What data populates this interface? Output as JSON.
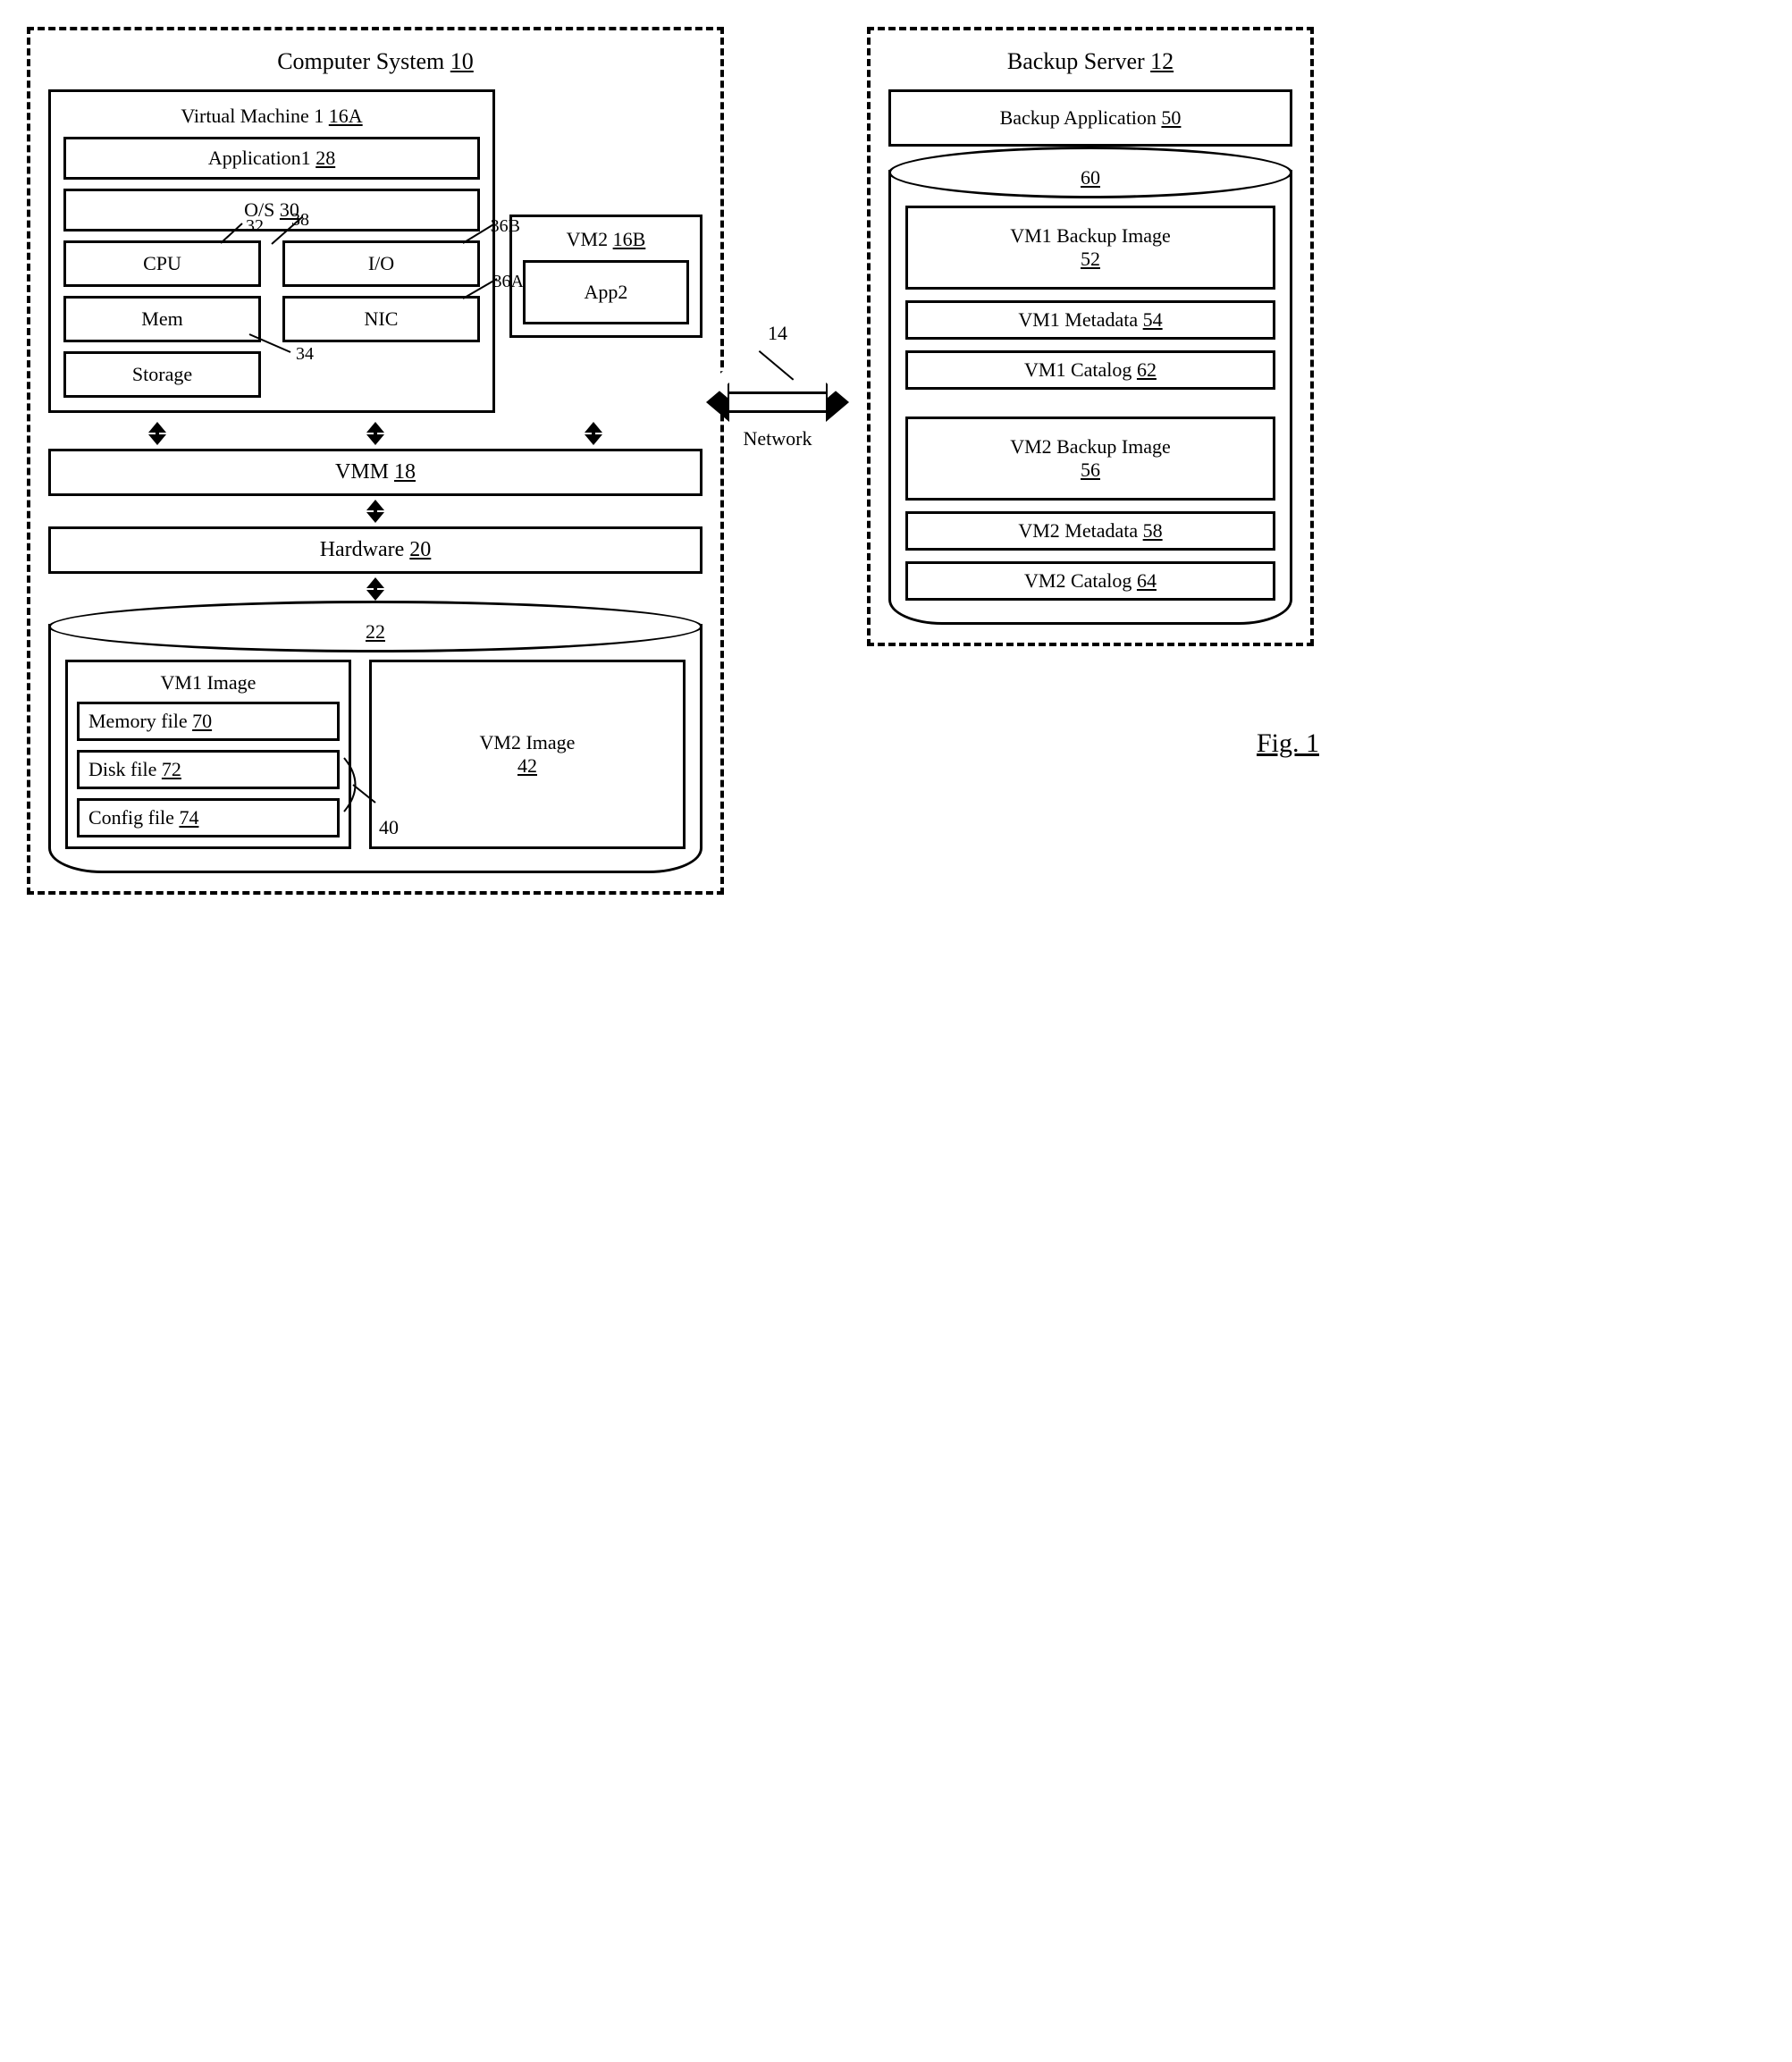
{
  "figure_label": "Fig. 1",
  "computer_system": {
    "title": "Computer System",
    "ref": "10",
    "vm1": {
      "title": "Virtual Machine 1",
      "ref": "16A",
      "app": {
        "label": "Application1",
        "ref": "28"
      },
      "os": {
        "label": "O/S",
        "ref": "30"
      },
      "cpu": {
        "label": "CPU",
        "ref": "32"
      },
      "mem": {
        "label": "Mem",
        "ref": "34"
      },
      "storage": {
        "label": "Storage"
      },
      "io": {
        "label": "I/O",
        "ref": "36B"
      },
      "nic": {
        "label": "NIC",
        "ref": "36A"
      },
      "divider_ref": "38"
    },
    "vm2": {
      "title": "VM2",
      "ref": "16B",
      "app": {
        "label": "App2"
      }
    },
    "vmm": {
      "label": "VMM",
      "ref": "18"
    },
    "hardware": {
      "label": "Hardware",
      "ref": "20"
    },
    "storage_cyl": {
      "ref": "22",
      "vm1_image": {
        "title": "VM1 Image",
        "memory_file": {
          "label": "Memory file",
          "ref": "70"
        },
        "disk_file": {
          "label": "Disk file",
          "ref": "72"
        },
        "config_file": {
          "label": "Config file",
          "ref": "74"
        },
        "group_ref": "40"
      },
      "vm2_image": {
        "label": "VM2 Image",
        "ref": "42"
      }
    }
  },
  "network": {
    "label": "Network",
    "ref": "14"
  },
  "backup_server": {
    "title": "Backup Server",
    "ref": "12",
    "backup_app": {
      "label": "Backup Application",
      "ref": "50"
    },
    "cylinder_ref": "60",
    "items": [
      {
        "label": "VM1 Backup Image",
        "ref": "52",
        "tall": true
      },
      {
        "label": "VM1 Metadata",
        "ref": "54"
      },
      {
        "label": "VM1 Catalog",
        "ref": "62"
      },
      {
        "label": "VM2 Backup Image",
        "ref": "56",
        "tall": true,
        "gap": true
      },
      {
        "label": "VM2 Metadata",
        "ref": "58"
      },
      {
        "label": "VM2 Catalog",
        "ref": "64"
      }
    ]
  }
}
